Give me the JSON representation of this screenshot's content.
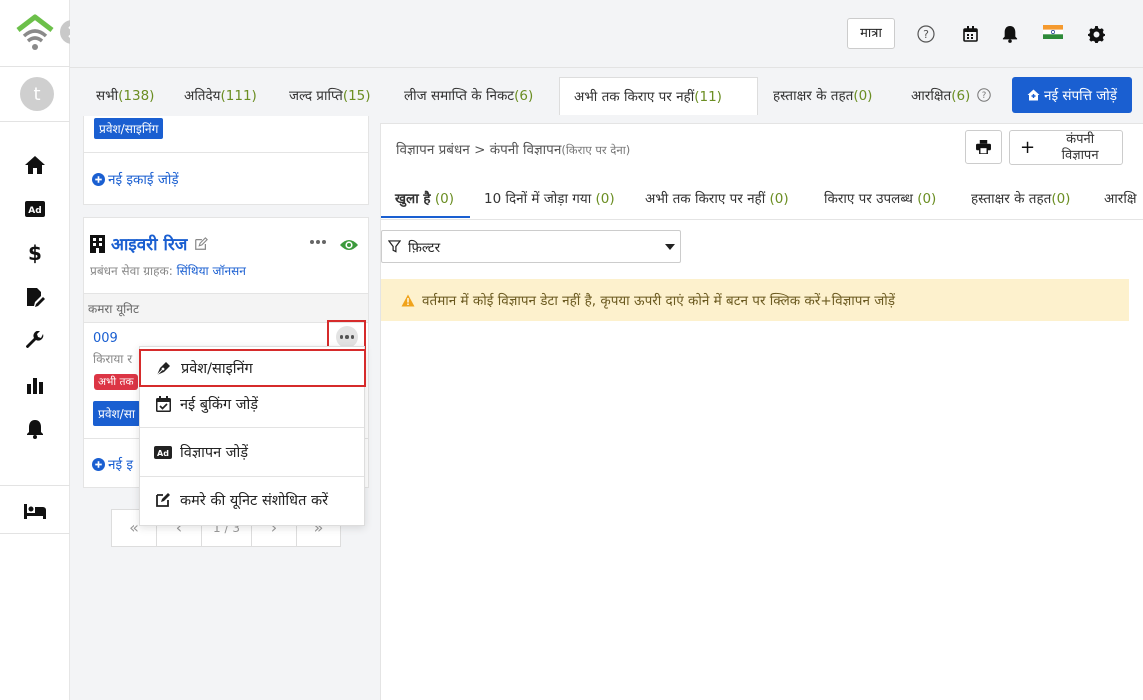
{
  "header": {
    "quantity_button": "मात्रा"
  },
  "avatar": {
    "initial": "t"
  },
  "tabs": [
    {
      "label": "सभी",
      "count": "(138)"
    },
    {
      "label": "अतिदेय",
      "count": "(111)"
    },
    {
      "label": "जल्द प्राप्ति",
      "count": "(15)"
    },
    {
      "label": "लीज समाप्ति के निकट",
      "count": "(6)"
    },
    {
      "label": "अभी तक किराए पर नहीं",
      "count": "(11)"
    },
    {
      "label": "हस्ताक्षर के तहत",
      "count": "(0)"
    },
    {
      "label": "आरक्षित",
      "count": "(6)"
    }
  ],
  "add_property_button": "नई संपत्ति जोड़ें",
  "left_panel": {
    "top_card": {
      "checkin_button": "प्रवेश/साइनिंग",
      "add_unit_link": "नई इकाई जोड़ें"
    },
    "property": {
      "name": "आइवरी रिज",
      "client_label": "प्रबंधन सेवा ग्राहक:",
      "client_name": "सिंथिया जॉनसन",
      "section_label": "कमरा यूनिट",
      "unit_number": "009",
      "unit_rent_label": "किराया र",
      "status_badge": "अभी तक",
      "checkin_button": "प्रवेश/सा",
      "add_unit_link": "नई इ"
    },
    "pagination": {
      "first": "«",
      "prev": "‹",
      "page": "1 / 3",
      "next": "›",
      "last": "»"
    }
  },
  "dropdown": {
    "items": [
      {
        "label": "प्रवेश/साइनिंग",
        "icon": "pen-nib-icon"
      },
      {
        "label": "नई बुकिंग जोड़ें",
        "icon": "calendar-check-icon"
      },
      {
        "label": "विज्ञापन जोड़ें",
        "icon": "ad-icon"
      },
      {
        "label": "कमरे की यूनिट संशोधित करें",
        "icon": "edit-icon"
      }
    ]
  },
  "main": {
    "breadcrumb_parent": "विज्ञापन प्रबंधन",
    "breadcrumb_sep": ">",
    "breadcrumb_current": "कंपनी विज्ञापन",
    "breadcrumb_note": "(किराए पर देना)",
    "company_ad_button": "कंपनी विज्ञापन",
    "sub_tabs": [
      {
        "label": "खुला है",
        "count": "(0)"
      },
      {
        "label": "10 दिनों में जोड़ा गया",
        "count": "(0)"
      },
      {
        "label": "अभी तक किराए पर नहीं",
        "count": "(0)"
      },
      {
        "label": "किराए पर उपलब्ध",
        "count": "(0)"
      },
      {
        "label": "हस्ताक्षर के तहत",
        "count": "(0)"
      },
      {
        "label": "आरक्षि",
        "count": ""
      }
    ],
    "filter_label": "फ़िल्टर",
    "notice": "वर्तमान में कोई विज्ञापन डेटा नहीं है, कृपया ऊपरी दाएं कोने में बटन पर क्लिक करें+विज्ञापन जोड़ें"
  }
}
